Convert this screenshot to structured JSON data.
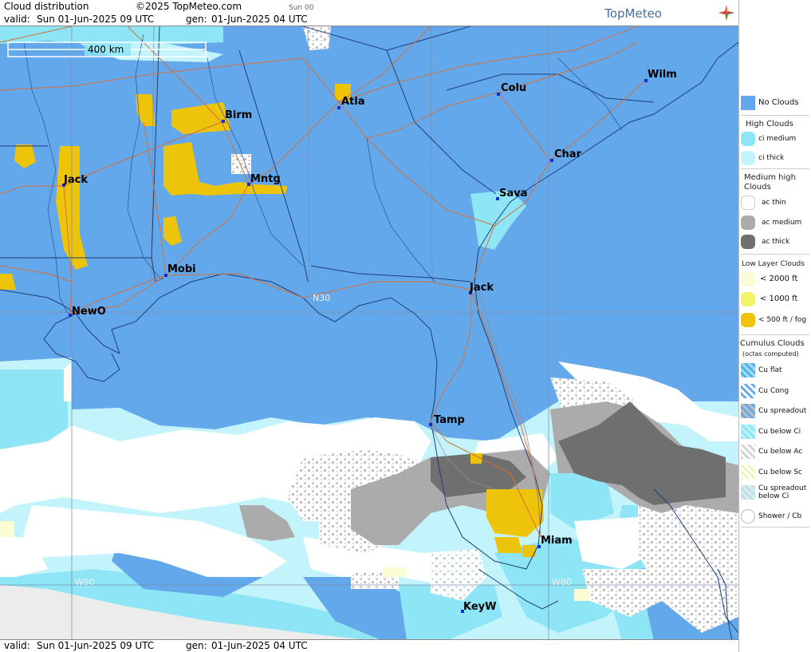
{
  "header": {
    "title": "Cloud distribution",
    "copyright": "©2025 TopMeteo.com",
    "run_tag": "Sun 00",
    "valid_label": "valid:",
    "valid_value": "Sun  01-Jun-2025  09 UTC",
    "gen_label": "gen:",
    "gen_value": "01-Jun-2025 04 UTC",
    "logo": "TopMeteo"
  },
  "footer": {
    "valid_label": "valid:",
    "valid_value": "Sun  01-Jun-2025  09 UTC",
    "gen_label": "gen:",
    "gen_value": "01-Jun-2025 04 UTC"
  },
  "map": {
    "scale_label": "400 km",
    "grid_labels": {
      "lat": "N30",
      "lon_w90": "W90",
      "lon_w80": "W80"
    },
    "cities": [
      "Birm",
      "Atla",
      "Colu",
      "Wilm",
      "Char",
      "Sava",
      "Jack",
      "Mntg",
      "Mobi",
      "NewO",
      "Jack",
      "Tamp",
      "Miam",
      "KeyW"
    ],
    "colors": {
      "no_clouds": "#64a8ec",
      "ci_medium": "#8ee5f5",
      "ci_thick": "#c4f4fb",
      "ac_thin": "#ffffff",
      "ac_medium": "#ababab",
      "ac_thick": "#6f6f6f",
      "low_2000": "#fbfbd4",
      "low_1000": "#f3f36a",
      "low_500": "#eec40a",
      "cu_speckle": "#d6d6d6",
      "roads": "#d2703a",
      "borders": "#1d3d78",
      "gray_area": "#ececec"
    }
  },
  "legend": {
    "no_clouds": "No Clouds",
    "high_header": "High Clouds",
    "ci_medium": "ci medium",
    "ci_thick": "ci thick",
    "medium_header": "Medium high Clouds",
    "ac_thin": "ac thin",
    "ac_medium": "ac medium",
    "ac_thick": "ac thick",
    "low_header": "Low Layer Clouds",
    "low_2000": "< 2000 ft",
    "low_1000": "< 1000 ft",
    "low_500": "< 500 ft / fog",
    "cu_header": "Cumulus Clouds",
    "cu_sub": "(octas computed)",
    "cu_flat": "Cu flat",
    "cu_cong": "Cu Cong",
    "cu_spreadout": "Cu spreadout",
    "cu_below_ci": "Cu below Ci",
    "cu_below_ac": "Cu below Ac",
    "cu_below_sc": "Cu below Sc",
    "cu_spreadout_below_ci": "Cu spreadout below Ci",
    "shower_cb": "Shower / Cb"
  }
}
